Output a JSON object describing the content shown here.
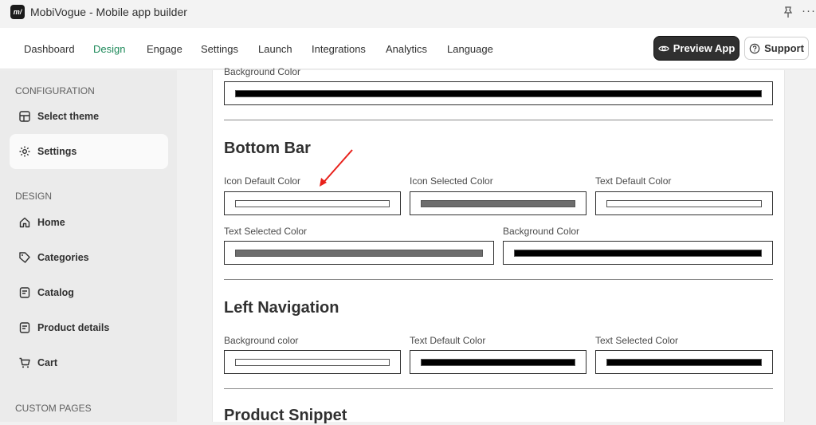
{
  "window": {
    "logo_text": "m/",
    "title": "MobiVogue - Mobile app builder",
    "pin_icon": "pin-icon",
    "more_icon": "more-icon",
    "more_glyph": "···"
  },
  "nav": {
    "tabs": [
      {
        "label": "Dashboard"
      },
      {
        "label": "Design",
        "active": true
      },
      {
        "label": "Engage"
      },
      {
        "label": "Settings"
      },
      {
        "label": "Launch"
      },
      {
        "label": "Integrations"
      },
      {
        "label": "Analytics"
      },
      {
        "label": "Language"
      }
    ],
    "preview_label": "Preview App",
    "support_label": "Support"
  },
  "sidebar": {
    "configuration_label": "CONFIGURATION",
    "config_items": [
      {
        "label": "Select theme",
        "icon": "theme-icon"
      },
      {
        "label": "Settings",
        "icon": "gear-icon",
        "active": true
      }
    ],
    "design_label": "DESIGN",
    "design_items": [
      {
        "label": "Home",
        "icon": "home-icon"
      },
      {
        "label": "Categories",
        "icon": "tag-icon"
      },
      {
        "label": "Catalog",
        "icon": "catalog-icon"
      },
      {
        "label": "Product details",
        "icon": "product-icon"
      },
      {
        "label": "Cart",
        "icon": "cart-icon"
      }
    ],
    "custom_pages_label": "CUSTOM PAGES"
  },
  "main": {
    "top_background_label": "Background Color",
    "top_background_color": "#000000",
    "bottom_bar": {
      "title": "Bottom Bar",
      "fields": [
        {
          "label": "Icon Default Color",
          "color": "#ffffff"
        },
        {
          "label": "Icon Selected Color",
          "color": "#6d6d6d"
        },
        {
          "label": "Text Default Color",
          "color": "#ffffff"
        },
        {
          "label": "Text Selected Color",
          "color": "#6d6d6d"
        },
        {
          "label": "Background Color",
          "color": "#000000"
        }
      ]
    },
    "left_navigation": {
      "title": "Left Navigation",
      "fields": [
        {
          "label": "Background color",
          "color": "#ffffff"
        },
        {
          "label": "Text Default Color",
          "color": "#000000"
        },
        {
          "label": "Text Selected Color",
          "color": "#000000"
        }
      ]
    },
    "product_snippet": {
      "title": "Product Snippet"
    }
  },
  "annotation": {
    "arrow_color": "#e8211b"
  }
}
